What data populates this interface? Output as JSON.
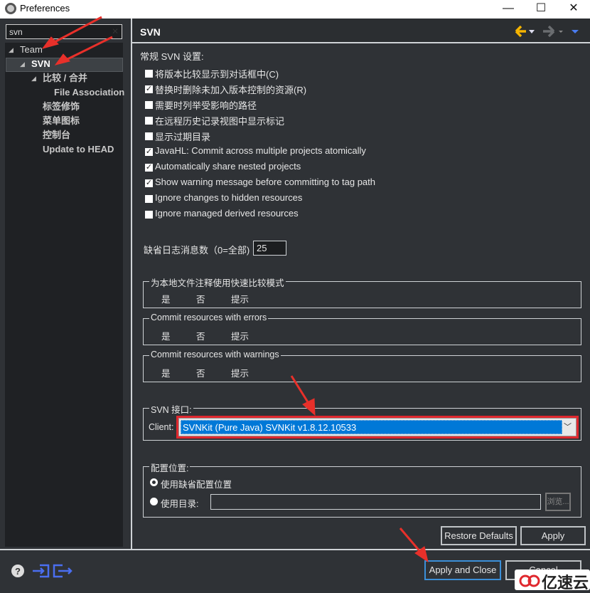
{
  "window": {
    "title": "Preferences",
    "controls": [
      "—",
      "☐",
      "✕"
    ]
  },
  "sidebar": {
    "search_value": "svn",
    "clear": "✕",
    "tree": [
      {
        "label": "Team",
        "expanded": true
      },
      {
        "label": "SVN",
        "expanded": true,
        "selected": true
      },
      {
        "label": "比较 / 合并",
        "expanded": true
      },
      {
        "label": "File Association"
      },
      {
        "label": "标签修饰"
      },
      {
        "label": "菜单图标"
      },
      {
        "label": "控制台"
      },
      {
        "label": "Update to HEAD"
      }
    ]
  },
  "header": {
    "title": "SVN",
    "icons": [
      "back-arrow-icon",
      "forward-arrow-icon",
      "view-menu-icon"
    ],
    "back_color": "#f5b400"
  },
  "general": {
    "label": "常规 SVN 设置:",
    "options": [
      {
        "label": "将版本比较显示到对话框中(C)",
        "checked": false
      },
      {
        "label": "替换时删除未加入版本控制的资源(R)",
        "checked": true
      },
      {
        "label": "需要时列举受影响的路径",
        "checked": false
      },
      {
        "label": "在远程历史记录视图中显示标记",
        "checked": false
      },
      {
        "label": "显示过期目录",
        "checked": false
      },
      {
        "label": "JavaHL: Commit across multiple projects atomically",
        "checked": true
      },
      {
        "label": "Automatically share nested projects",
        "checked": true
      },
      {
        "label": "Show warning message before committing to tag path",
        "checked": true
      },
      {
        "label": "Ignore changes to hidden resources",
        "checked": false
      },
      {
        "label": "Ignore managed derived resources",
        "checked": false
      }
    ]
  },
  "log": {
    "label": "缺省日志消息数（0=全部)",
    "value": "25"
  },
  "groups": [
    {
      "title": "为本地文件注释使用快速比较模式",
      "options": [
        "是",
        "否",
        "提示"
      ]
    },
    {
      "title": "Commit resources with errors",
      "options": [
        "是",
        "否",
        "提示"
      ]
    },
    {
      "title": "Commit resources with warnings",
      "options": [
        "是",
        "否",
        "提示"
      ]
    }
  ],
  "svn_interface": {
    "title": "SVN 接口:",
    "client_label": "Client:",
    "client_value": "SVNKit (Pure Java) SVNKit v1.8.12.10533",
    "highlight_color": "#e0282e",
    "selection_color": "#0078d7"
  },
  "config": {
    "title": "配置位置:",
    "default_label": "使用缺省配置位置",
    "dir_label": "使用目录:",
    "dir_value": "",
    "browse": "浏览..."
  },
  "buttons": {
    "restore": "Restore Defaults",
    "apply": "Apply",
    "apply_close": "Apply and Close",
    "cancel": "Cancel"
  },
  "footer_icons": [
    "help-icon",
    "import-icon",
    "export-icon"
  ],
  "watermark": "亿速云"
}
